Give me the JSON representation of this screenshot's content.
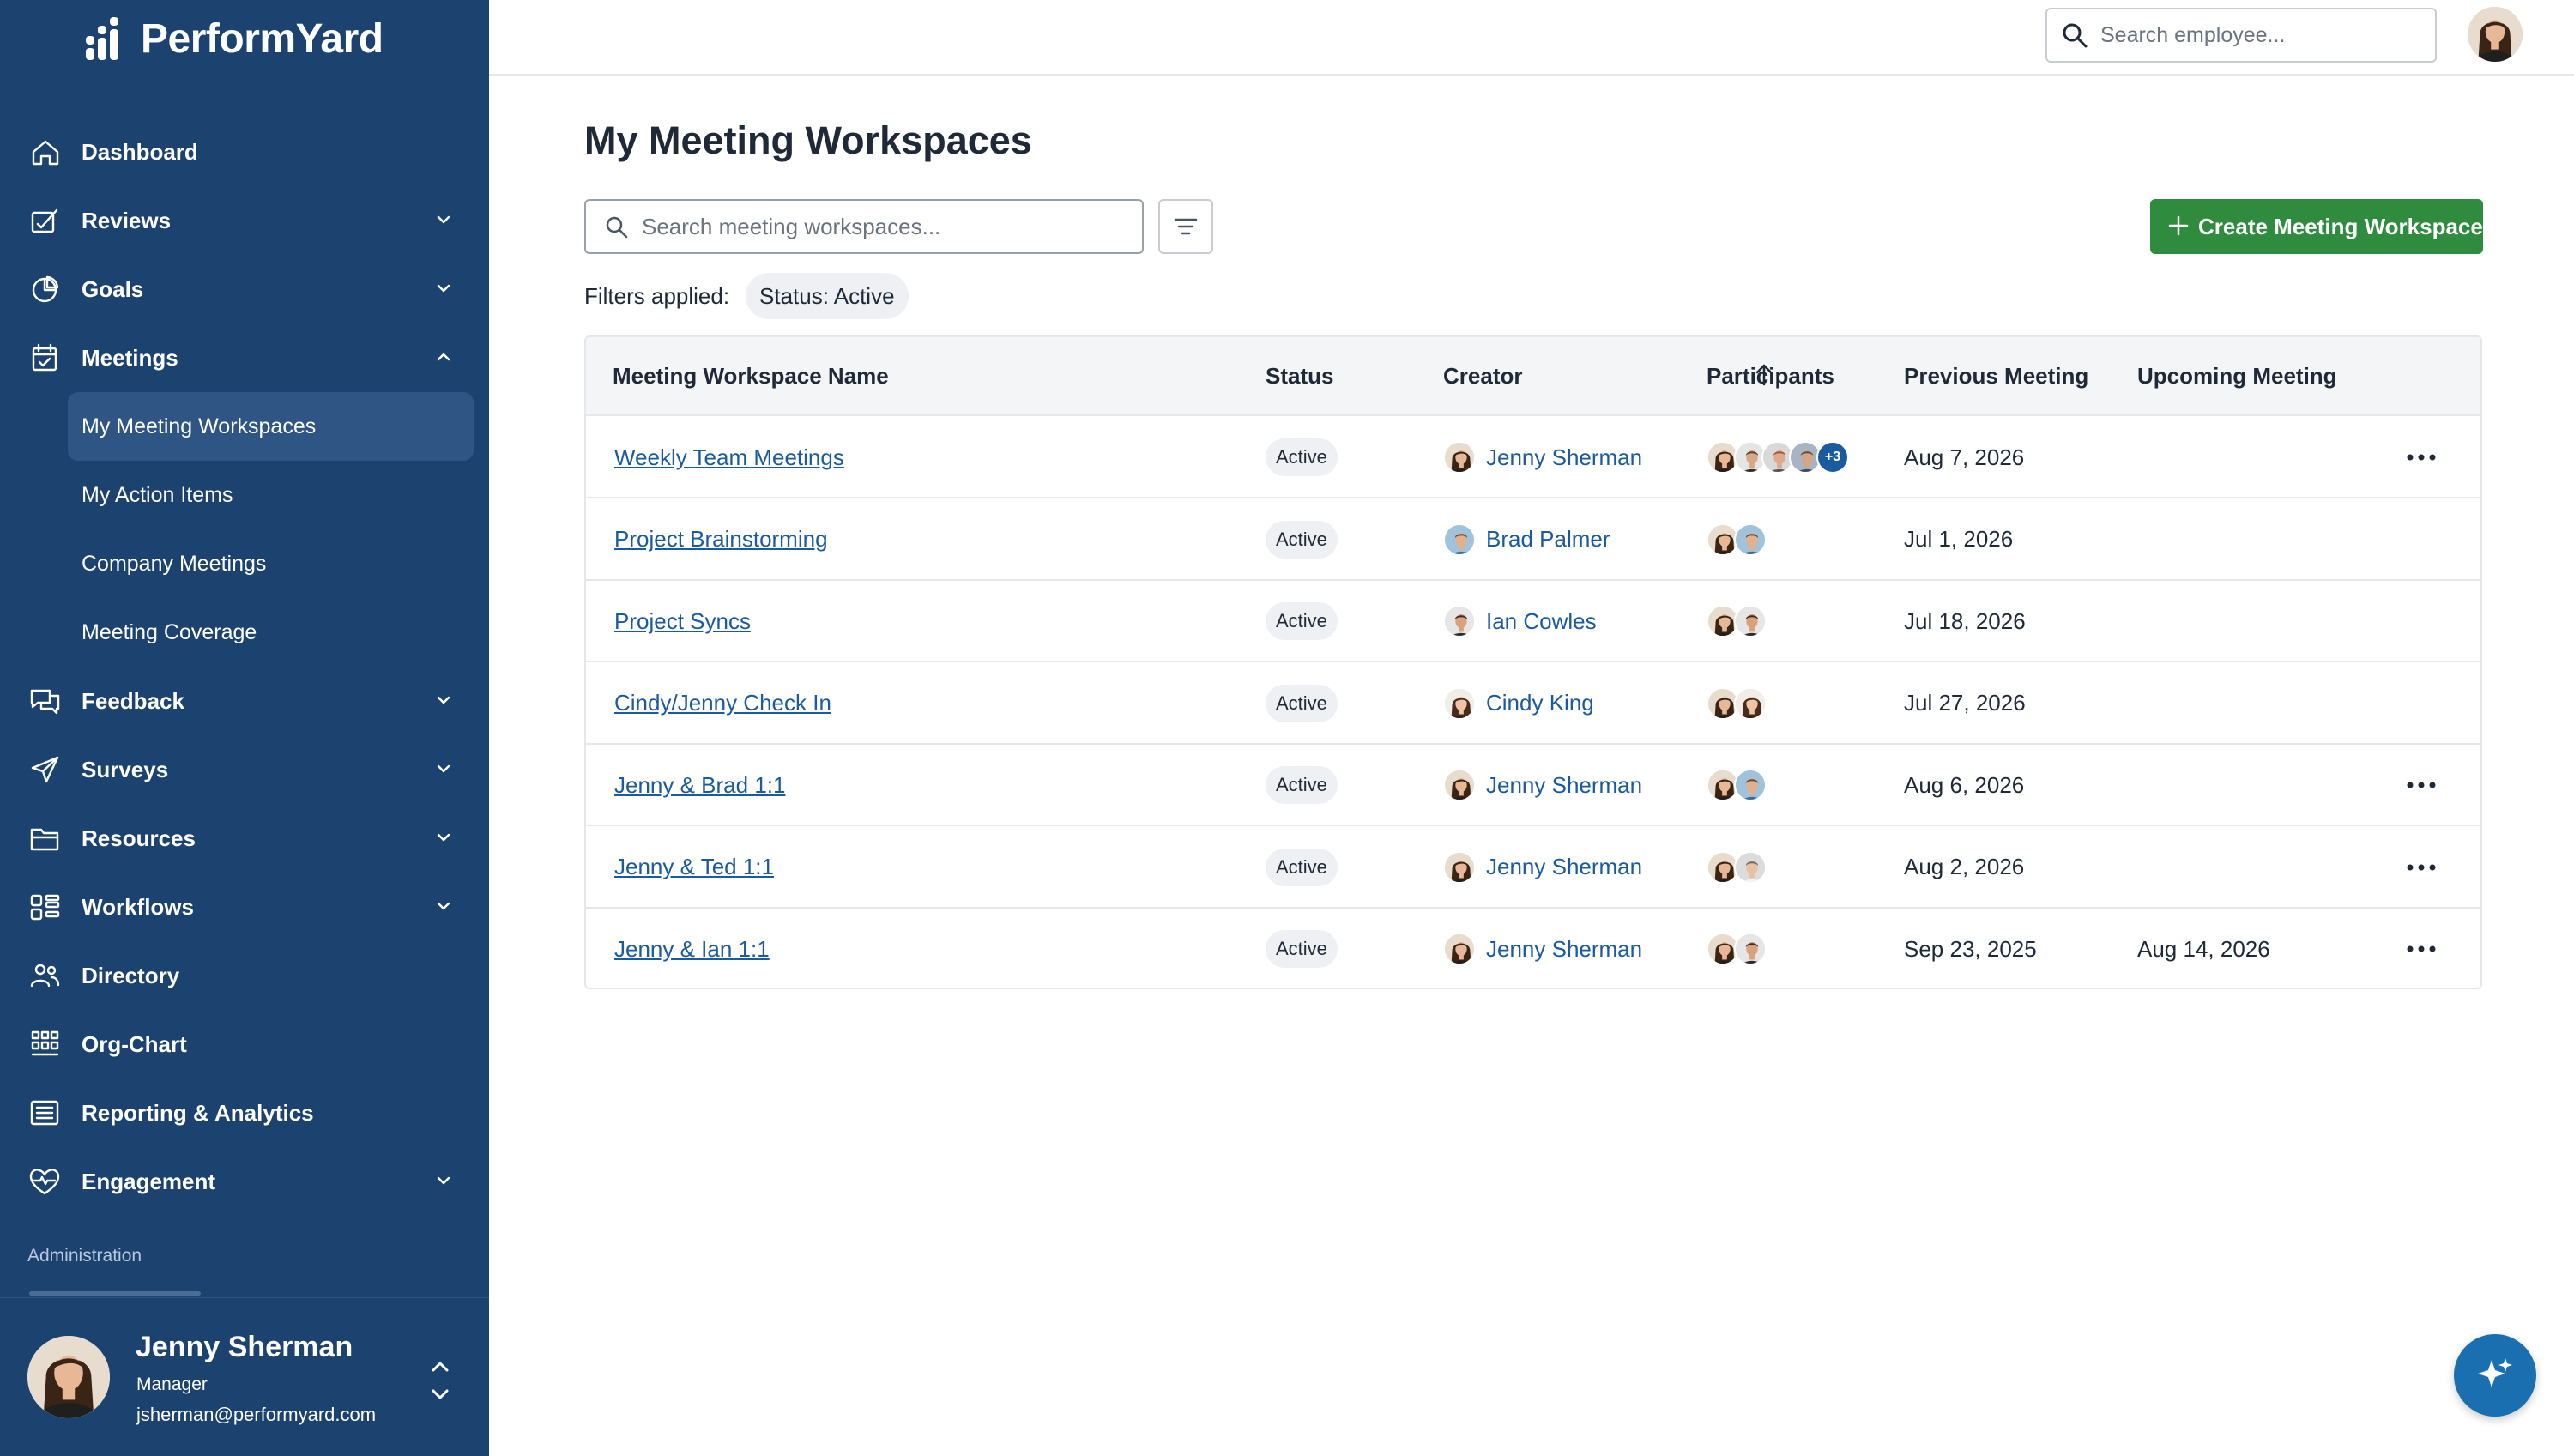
{
  "app": {
    "name": "PerformYard"
  },
  "colors": {
    "sidebar": "#1c4270",
    "accent": "#1a5a9e",
    "create_button": "#2f8b3e",
    "active_sub_item": "#2f5585"
  },
  "sidebar": {
    "items": [
      {
        "label": "Dashboard",
        "icon": "home-icon",
        "has_chevron": false
      },
      {
        "label": "Reviews",
        "icon": "reviews-icon",
        "has_chevron": true
      },
      {
        "label": "Goals",
        "icon": "pie-chart-icon",
        "has_chevron": true
      },
      {
        "label": "Meetings",
        "icon": "calendar-check-icon",
        "has_chevron": true,
        "expanded": true
      },
      {
        "label": "Feedback",
        "icon": "chat-bubbles-icon",
        "has_chevron": true
      },
      {
        "label": "Surveys",
        "icon": "send-icon",
        "has_chevron": true
      },
      {
        "label": "Resources",
        "icon": "folder-icon",
        "has_chevron": true
      },
      {
        "label": "Workflows",
        "icon": "workflow-icon",
        "has_chevron": true
      },
      {
        "label": "Directory",
        "icon": "people-icon",
        "has_chevron": false
      },
      {
        "label": "Org-Chart",
        "icon": "org-chart-icon",
        "has_chevron": false
      },
      {
        "label": "Reporting & Analytics",
        "icon": "report-icon",
        "has_chevron": false
      },
      {
        "label": "Engagement",
        "icon": "heart-pulse-icon",
        "has_chevron": true
      }
    ],
    "meetings_sub": [
      {
        "label": "My Meeting Workspaces",
        "active": true
      },
      {
        "label": "My Action Items",
        "active": false
      },
      {
        "label": "Company Meetings",
        "active": false
      },
      {
        "label": "Meeting Coverage",
        "active": false
      }
    ],
    "admin_label": "Administration"
  },
  "user": {
    "name": "Jenny Sherman",
    "role": "Manager",
    "email": "jsherman@performyard.com"
  },
  "topbar": {
    "search_placeholder": "Search employee..."
  },
  "main": {
    "title": "My Meeting Workspaces",
    "search_placeholder": "Search meeting workspaces...",
    "create_label": "Create Meeting Workspace",
    "filters_label": "Filters applied:",
    "filter_chip": "Status: Active"
  },
  "table": {
    "headers": {
      "name": "Meeting Workspace Name",
      "status": "Status",
      "creator": "Creator",
      "participants": "Participants",
      "previous": "Previous Meeting",
      "upcoming": "Upcoming Meeting"
    },
    "rows": [
      {
        "name": "Weekly Team Meetings",
        "status": "Active",
        "creator": "Jenny Sherman",
        "creator_avatar": "jenny",
        "participants": [
          "jenny",
          "man1",
          "man2",
          "man3"
        ],
        "extra": "+3",
        "previous": "Aug 7, 2026",
        "upcoming": "",
        "menu": true
      },
      {
        "name": "Project Brainstorming",
        "status": "Active",
        "creator": "Brad Palmer",
        "creator_avatar": "brad",
        "participants": [
          "jenny",
          "brad"
        ],
        "extra": "",
        "previous": "Jul 1, 2026",
        "upcoming": "",
        "menu": false
      },
      {
        "name": "Project Syncs",
        "status": "Active",
        "creator": "Ian Cowles",
        "creator_avatar": "ian",
        "participants": [
          "jenny",
          "ian"
        ],
        "extra": "",
        "previous": "Jul 18, 2026",
        "upcoming": "",
        "menu": false
      },
      {
        "name": "Cindy/Jenny Check In",
        "status": "Active",
        "creator": "Cindy King",
        "creator_avatar": "cindy",
        "participants": [
          "jenny",
          "cindy"
        ],
        "extra": "",
        "previous": "Jul 27, 2026",
        "upcoming": "",
        "menu": false
      },
      {
        "name": "Jenny & Brad 1:1",
        "status": "Active",
        "creator": "Jenny Sherman",
        "creator_avatar": "jenny",
        "participants": [
          "jenny",
          "brad"
        ],
        "extra": "",
        "previous": "Aug 6, 2026",
        "upcoming": "",
        "menu": true
      },
      {
        "name": "Jenny & Ted 1:1",
        "status": "Active",
        "creator": "Jenny Sherman",
        "creator_avatar": "jenny",
        "participants": [
          "jenny",
          "ted"
        ],
        "extra": "",
        "previous": "Aug 2, 2026",
        "upcoming": "",
        "menu": true
      },
      {
        "name": "Jenny & Ian 1:1",
        "status": "Active",
        "creator": "Jenny Sherman",
        "creator_avatar": "jenny",
        "participants": [
          "jenny",
          "ian"
        ],
        "extra": "",
        "previous": "Sep 23, 2025",
        "upcoming": "Aug 14, 2026",
        "menu": true
      }
    ]
  }
}
